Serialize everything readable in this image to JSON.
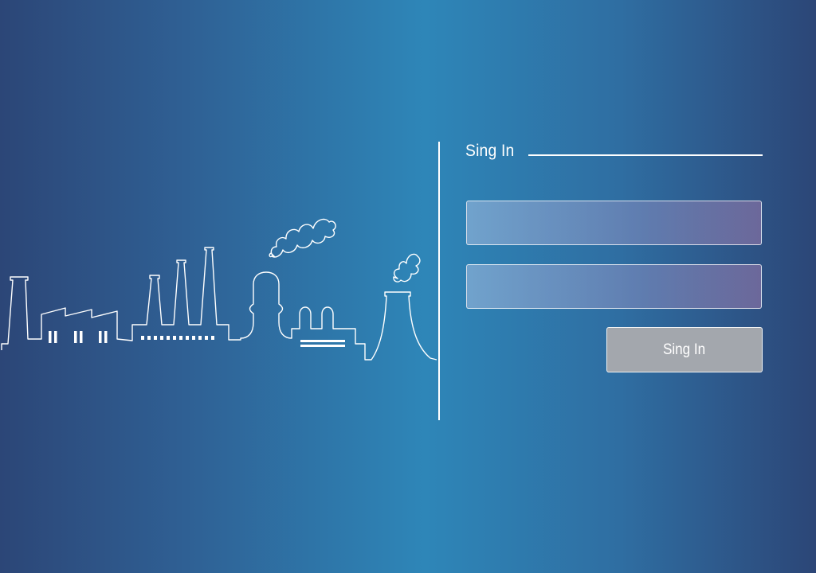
{
  "background": {
    "edge_color": "#2c4677",
    "center_color": "#2e86b8"
  },
  "illustration": {
    "name": "industrial-skyline-line-art",
    "stroke_color": "#ffffff"
  },
  "form": {
    "title": "Sing In",
    "username": {
      "value": "",
      "placeholder": ""
    },
    "password": {
      "value": "",
      "placeholder": ""
    },
    "submit_label": "Sing In",
    "button_color": "#a3a7ad"
  }
}
